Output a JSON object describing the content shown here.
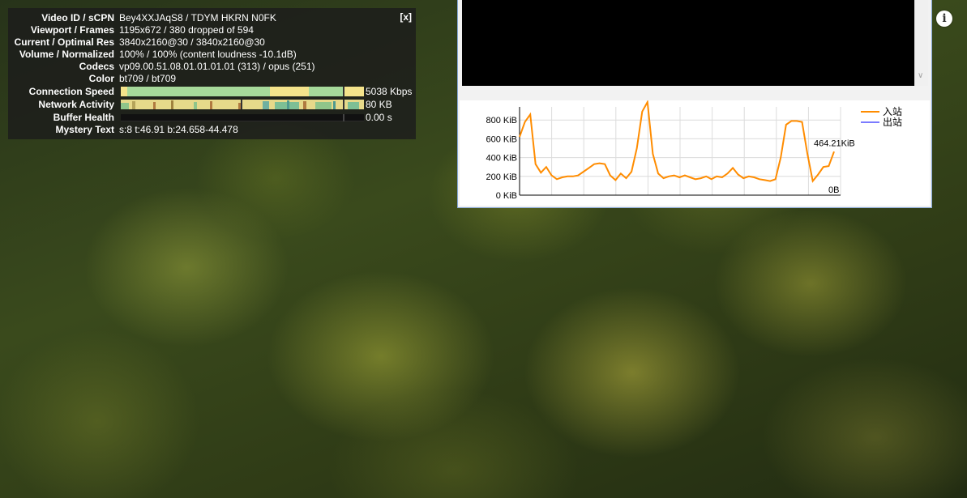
{
  "stats": {
    "close_label": "[x]",
    "rows": [
      {
        "label": "Video ID / sCPN",
        "value": "Bey4XXJAqS8 / TDYM HKRN N0FK"
      },
      {
        "label": "Viewport / Frames",
        "value": "1195x672 / 380 dropped of 594"
      },
      {
        "label": "Current / Optimal Res",
        "value": "3840x2160@30 / 3840x2160@30"
      },
      {
        "label": "Volume / Normalized",
        "value": "100% / 100% (content loudness -10.1dB)"
      },
      {
        "label": "Codecs",
        "value": "vp09.00.51.08.01.01.01.01 (313) / opus (251)"
      },
      {
        "label": "Color",
        "value": "bt709 / bt709"
      }
    ],
    "connection_speed": {
      "label": "Connection Speed",
      "value": "5038 Kbps"
    },
    "network_activity": {
      "label": "Network Activity",
      "value": "80 KB"
    },
    "buffer_health": {
      "label": "Buffer Health",
      "value": "0.00 s"
    },
    "mystery_text": {
      "label": "Mystery Text",
      "value": "s:8 t:46.91 b:24.658-44.478"
    }
  },
  "colors": {
    "bar_green": "#a6d99a",
    "bar_yellow": "#f4e38b",
    "inbound_line": "#ff8c00",
    "outbound_line": "#7b7bff"
  },
  "chart_data": {
    "type": "line",
    "y_tick_labels": [
      "800 KiB",
      "600 KiB",
      "400 KiB",
      "200 KiB",
      "0 KiB"
    ],
    "ylim": [
      0,
      940
    ],
    "current_value_label": "464.21KiB",
    "zero_label": "0B",
    "grid": true,
    "legend_position": "top-right",
    "series": [
      {
        "name": "入站",
        "color": "#ff8c00",
        "values": [
          620,
          780,
          860,
          330,
          240,
          300,
          210,
          170,
          190,
          200,
          200,
          210,
          250,
          290,
          330,
          340,
          330,
          210,
          160,
          230,
          180,
          250,
          500,
          890,
          1000,
          440,
          230,
          180,
          200,
          210,
          190,
          210,
          190,
          170,
          180,
          200,
          170,
          200,
          190,
          230,
          290,
          220,
          180,
          200,
          190,
          170,
          160,
          150,
          170,
          400,
          750,
          790,
          790,
          780,
          440,
          150,
          220,
          300,
          310,
          464
        ]
      },
      {
        "name": "出站",
        "color": "#7b7bff",
        "values": []
      }
    ]
  }
}
